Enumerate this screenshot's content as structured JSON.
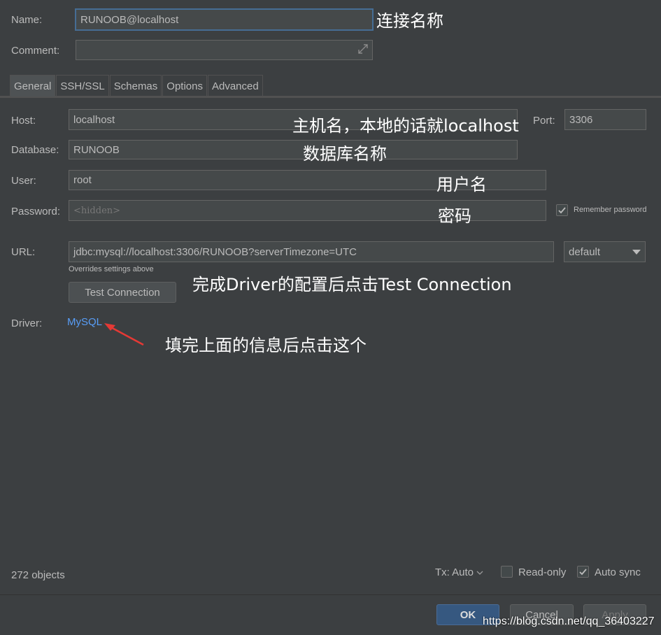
{
  "form": {
    "name_label": "Name:",
    "name_value": "RUNOOB@localhost",
    "comment_label": "Comment:",
    "comment_value": ""
  },
  "tabs": [
    {
      "label": "General",
      "active": true
    },
    {
      "label": "SSH/SSL",
      "active": false
    },
    {
      "label": "Schemas",
      "active": false
    },
    {
      "label": "Options",
      "active": false
    },
    {
      "label": "Advanced",
      "active": false
    }
  ],
  "general": {
    "host_label": "Host:",
    "host_value": "localhost",
    "port_label": "Port:",
    "port_value": "3306",
    "database_label": "Database:",
    "database_value": "RUNOOB",
    "user_label": "User:",
    "user_value": "root",
    "password_label": "Password:",
    "password_placeholder": "<hidden>",
    "remember_label": "Remember password",
    "url_label": "URL:",
    "url_value": "jdbc:mysql://localhost:3306/RUNOOB?serverTimezone=UTC",
    "url_mode": "default",
    "overrides_note": "Overrides settings above",
    "test_connection_label": "Test Connection",
    "driver_label": "Driver:",
    "driver_value": "MySQL"
  },
  "annotations": {
    "name": "连接名称",
    "host": "主机名，本地的话就localhost",
    "database": "数据库名称",
    "user": "用户名",
    "password": "密码",
    "test": "完成Driver的配置后点击Test Connection",
    "driver": "填完上面的信息后点击这个"
  },
  "footer": {
    "objects_count": "272 objects",
    "tx_label": "Tx: Auto",
    "readonly_label": "Read-only",
    "autosync_label": "Auto sync",
    "ok_label": "OK",
    "cancel_label": "Cancel",
    "apply_label": "Apply",
    "watermark": "https://blog.csdn.net/qq_36403227"
  },
  "colors": {
    "background": "#3c3f41",
    "link": "#589df6",
    "ok_button": "#365880",
    "arrow": "#e53935"
  }
}
